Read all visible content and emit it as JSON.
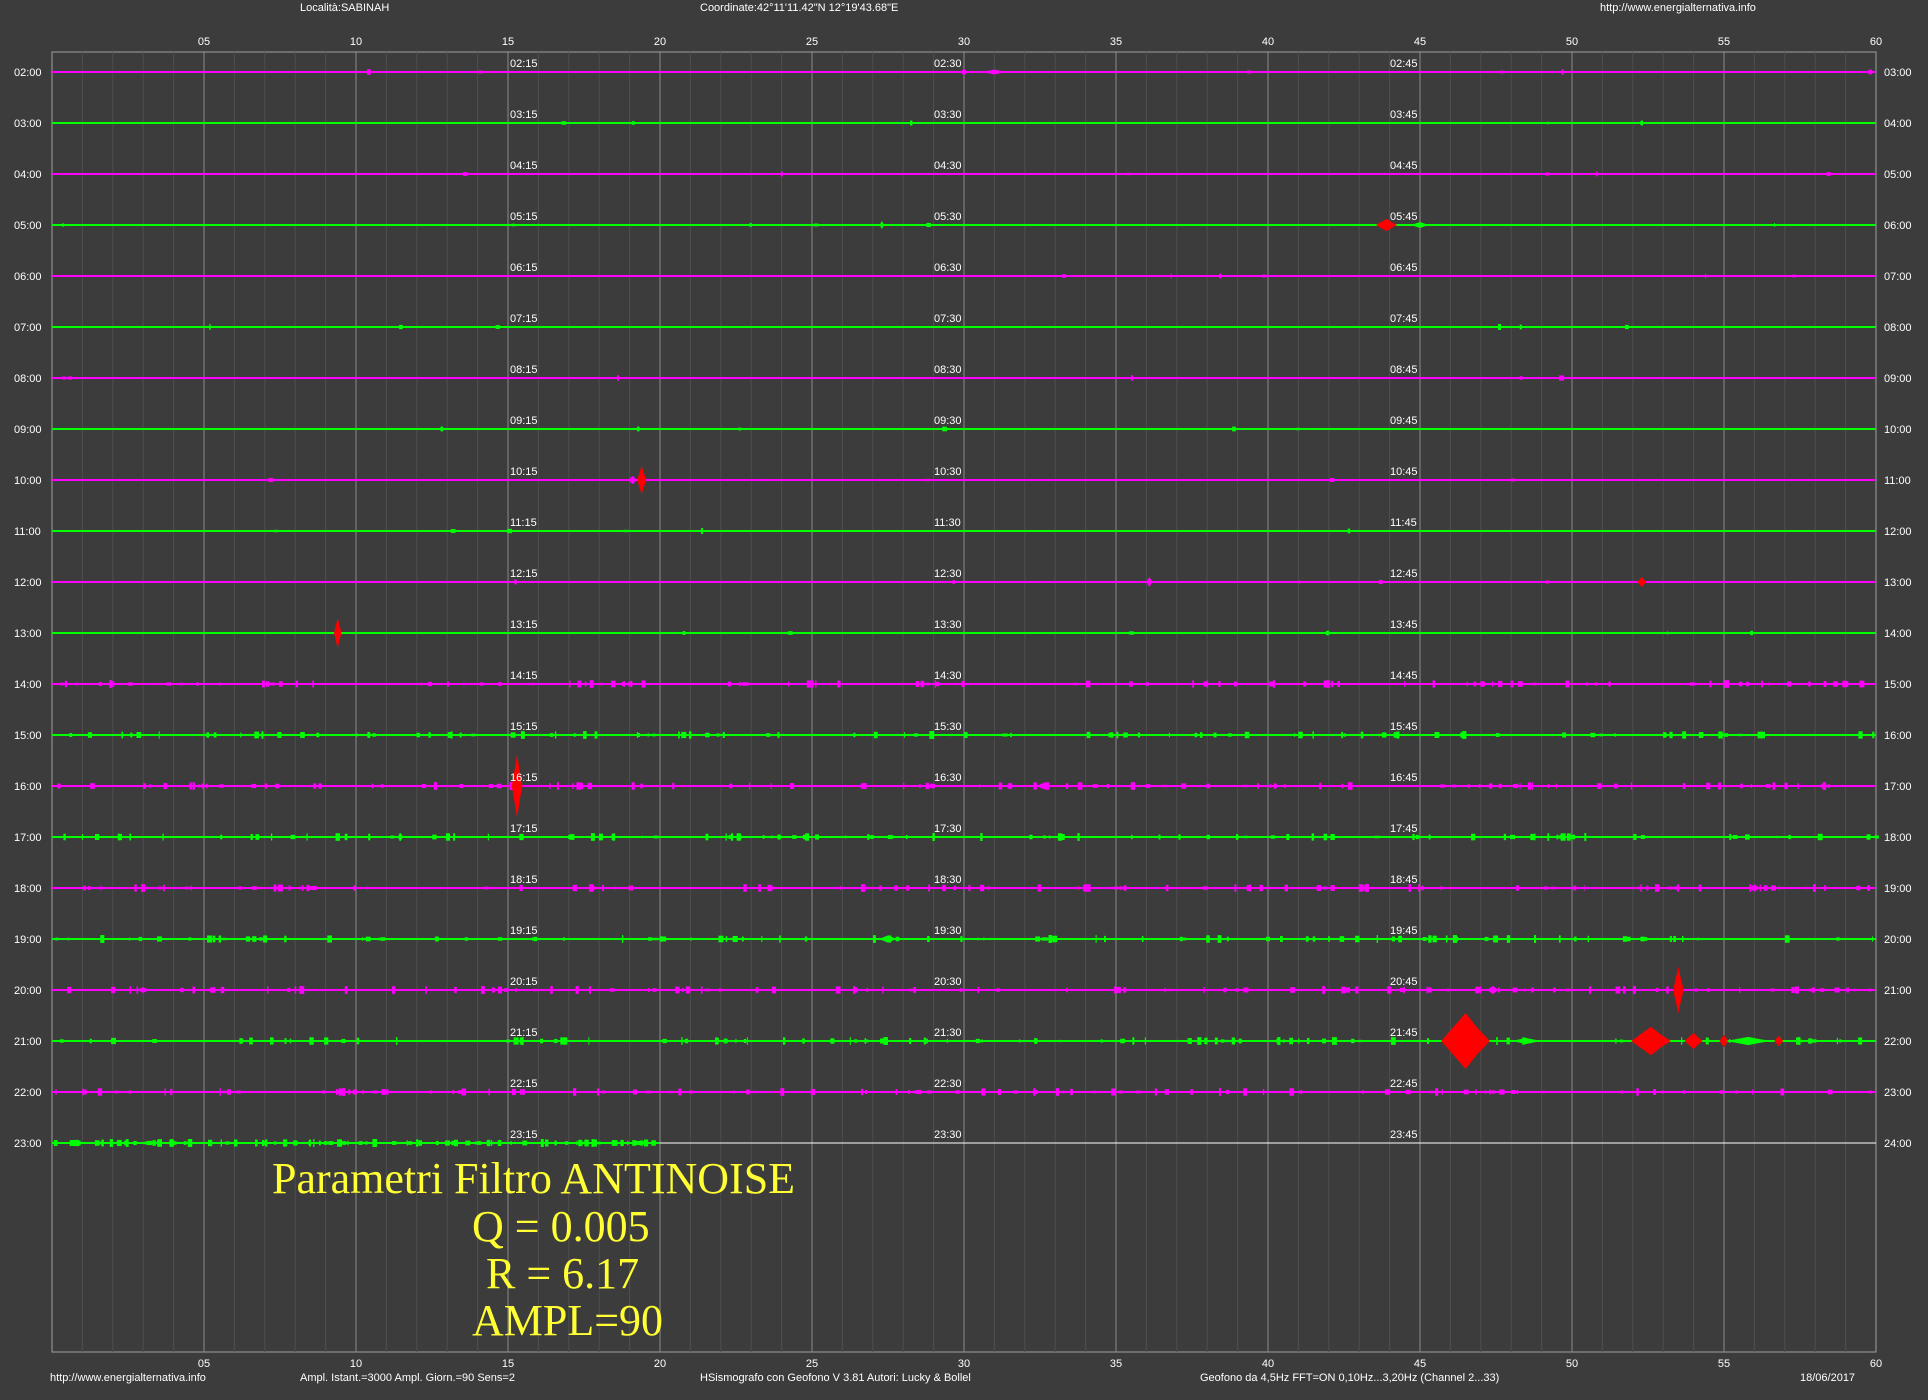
{
  "header": {
    "location": "Località:SABINAH",
    "coordinates": "Coordinate:42°11'11.42\"N  12°19'43.68\"E",
    "website": "http://www.energialternativa.info"
  },
  "footer": {
    "website": "http://www.energialternativa.info",
    "amplitude_info": "Ampl. Istant.=3000 Ampl. Giorn.=90 Sens=2",
    "software": "HSismografo con Geofono V 3.81  Autori: Lucky & Bollel",
    "sensor_info": "Geofono da 4,5Hz FFT=ON 0,10Hz...3,20Hz      (Channel 2...33)",
    "date": "18/06/2017"
  },
  "filter_box": {
    "title": "Parametri Filtro ANTINOISE",
    "q": "Q = 0.005",
    "r": "R = 6.17",
    "ampl": "AMPL=90"
  },
  "colors": {
    "background": "#3c3c3c",
    "trace_odd": "#ff00ff",
    "trace_even": "#00ff00",
    "event": "#ff0000",
    "grid": "#a0a0a0",
    "text": "#ffffff",
    "filter_text": "#ffff33"
  },
  "chart_data": {
    "type": "line",
    "description_type": "helicorder",
    "x_unit": "minutes",
    "xlim": [
      0,
      60
    ],
    "x_ticks": [
      "05",
      "10",
      "15",
      "20",
      "25",
      "30",
      "35",
      "40",
      "45",
      "50",
      "55",
      "60"
    ],
    "rows": [
      {
        "left": "02:00",
        "right": "03:00",
        "q15": "02:15",
        "q30": "02:30",
        "q45": "02:45"
      },
      {
        "left": "03:00",
        "right": "04:00",
        "q15": "03:15",
        "q30": "03:30",
        "q45": "03:45"
      },
      {
        "left": "04:00",
        "right": "05:00",
        "q15": "04:15",
        "q30": "04:30",
        "q45": "04:45"
      },
      {
        "left": "05:00",
        "right": "06:00",
        "q15": "05:15",
        "q30": "05:30",
        "q45": "05:45"
      },
      {
        "left": "06:00",
        "right": "07:00",
        "q15": "06:15",
        "q30": "06:30",
        "q45": "06:45"
      },
      {
        "left": "07:00",
        "right": "08:00",
        "q15": "07:15",
        "q30": "07:30",
        "q45": "07:45"
      },
      {
        "left": "08:00",
        "right": "09:00",
        "q15": "08:15",
        "q30": "08:30",
        "q45": "08:45"
      },
      {
        "left": "09:00",
        "right": "10:00",
        "q15": "09:15",
        "q30": "09:30",
        "q45": "09:45"
      },
      {
        "left": "10:00",
        "right": "11:00",
        "q15": "10:15",
        "q30": "10:30",
        "q45": "10:45"
      },
      {
        "left": "11:00",
        "right": "12:00",
        "q15": "11:15",
        "q30": "11:30",
        "q45": "11:45"
      },
      {
        "left": "12:00",
        "right": "13:00",
        "q15": "12:15",
        "q30": "12:30",
        "q45": "12:45"
      },
      {
        "left": "13:00",
        "right": "14:00",
        "q15": "13:15",
        "q30": "13:30",
        "q45": "13:45"
      },
      {
        "left": "14:00",
        "right": "15:00",
        "q15": "14:15",
        "q30": "14:30",
        "q45": "14:45"
      },
      {
        "left": "15:00",
        "right": "16:00",
        "q15": "15:15",
        "q30": "15:30",
        "q45": "15:45"
      },
      {
        "left": "16:00",
        "right": "17:00",
        "q15": "16:15",
        "q30": "16:30",
        "q45": "16:45"
      },
      {
        "left": "17:00",
        "right": "18:00",
        "q15": "17:15",
        "q30": "17:30",
        "q45": "17:45"
      },
      {
        "left": "18:00",
        "right": "19:00",
        "q15": "18:15",
        "q30": "18:30",
        "q45": "18:45"
      },
      {
        "left": "19:00",
        "right": "20:00",
        "q15": "19:15",
        "q30": "19:30",
        "q45": "19:45"
      },
      {
        "left": "20:00",
        "right": "21:00",
        "q15": "20:15",
        "q30": "20:30",
        "q45": "20:45"
      },
      {
        "left": "21:00",
        "right": "22:00",
        "q15": "21:15",
        "q30": "21:30",
        "q45": "21:45"
      },
      {
        "left": "22:00",
        "right": "23:00",
        "q15": "22:15",
        "q30": "22:30",
        "q45": "22:45"
      },
      {
        "left": "23:00",
        "right": "24:00",
        "q15": "23:15",
        "q30": "23:30",
        "q45": "23:45"
      }
    ],
    "trace_colors": [
      "#ff00ff",
      "#00ff00"
    ],
    "last_row_trace_end_minute": 20,
    "events": [
      {
        "row": 0,
        "minute": 30.0,
        "amp": 0.06,
        "width": 0.3,
        "color": "#ff00ff"
      },
      {
        "row": 0,
        "minute": 31.0,
        "amp": 0.05,
        "width": 0.8,
        "color": "#ff00ff"
      },
      {
        "row": 3,
        "minute": 27.3,
        "amp": 0.08,
        "width": 0.15,
        "color": "#00ff00"
      },
      {
        "row": 3,
        "minute": 43.9,
        "amp": 0.12,
        "width": 0.7,
        "color": "#ff0000"
      },
      {
        "row": 3,
        "minute": 45.0,
        "amp": 0.06,
        "width": 0.6,
        "color": "#00ff00"
      },
      {
        "row": 8,
        "minute": 19.1,
        "amp": 0.08,
        "width": 0.3,
        "color": "#ff00ff"
      },
      {
        "row": 8,
        "minute": 19.4,
        "amp": 0.28,
        "width": 0.3,
        "color": "#ff0000"
      },
      {
        "row": 10,
        "minute": 36.1,
        "amp": 0.1,
        "width": 0.2,
        "color": "#ff00ff"
      },
      {
        "row": 10,
        "minute": 52.3,
        "amp": 0.1,
        "width": 0.3,
        "color": "#ff0000"
      },
      {
        "row": 11,
        "minute": 9.4,
        "amp": 0.3,
        "width": 0.25,
        "color": "#ff0000"
      },
      {
        "row": 14,
        "minute": 15.3,
        "amp": 0.62,
        "width": 0.35,
        "color": "#ff0000"
      },
      {
        "row": 14,
        "minute": 32.6,
        "amp": 0.06,
        "width": 0.4,
        "color": "#ff00ff"
      },
      {
        "row": 16,
        "minute": 56.0,
        "amp": 0.07,
        "width": 0.4,
        "color": "#ff00ff"
      },
      {
        "row": 17,
        "minute": 27.5,
        "amp": 0.07,
        "width": 0.6,
        "color": "#00ff00"
      },
      {
        "row": 18,
        "minute": 3.0,
        "amp": 0.06,
        "width": 0.4,
        "color": "#ff00ff"
      },
      {
        "row": 18,
        "minute": 47.4,
        "amp": 0.08,
        "width": 0.4,
        "color": "#ff00ff"
      },
      {
        "row": 18,
        "minute": 53.5,
        "amp": 0.45,
        "width": 0.35,
        "color": "#ff0000"
      },
      {
        "row": 19,
        "minute": 46.5,
        "amp": 0.55,
        "width": 1.6,
        "color": "#ff0000"
      },
      {
        "row": 19,
        "minute": 52.6,
        "amp": 0.28,
        "width": 1.3,
        "color": "#ff0000"
      },
      {
        "row": 19,
        "minute": 54.0,
        "amp": 0.16,
        "width": 0.6,
        "color": "#ff0000"
      },
      {
        "row": 19,
        "minute": 55.0,
        "amp": 0.12,
        "width": 0.3,
        "color": "#ff0000"
      },
      {
        "row": 19,
        "minute": 56.8,
        "amp": 0.1,
        "width": 0.3,
        "color": "#ff0000"
      },
      {
        "row": 19,
        "minute": 55.8,
        "amp": 0.08,
        "width": 1.5,
        "color": "#00ff00"
      },
      {
        "row": 19,
        "minute": 48.5,
        "amp": 0.06,
        "width": 1.0,
        "color": "#00ff00"
      }
    ]
  }
}
